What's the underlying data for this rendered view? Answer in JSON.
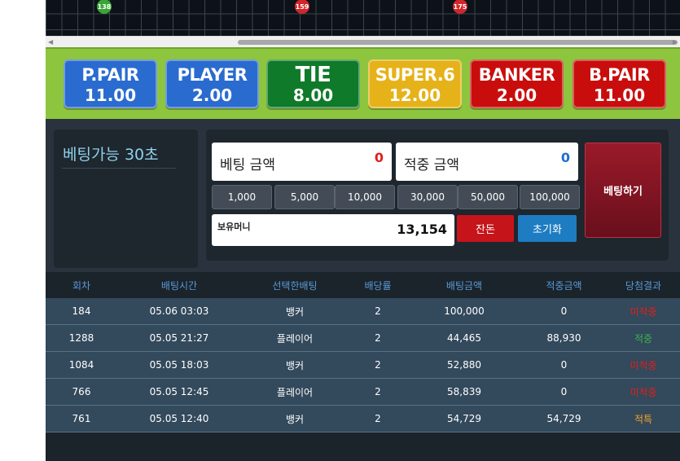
{
  "road": {
    "beads": [
      {
        "num": "138",
        "color": "green"
      },
      {
        "num": "159",
        "color": "red"
      },
      {
        "num": "175",
        "color": "red"
      }
    ]
  },
  "bets": [
    {
      "name": "P.PAIR",
      "odds": "11.00",
      "style": "blue"
    },
    {
      "name": "PLAYER",
      "odds": "2.00",
      "style": "blue"
    },
    {
      "name": "TIE",
      "odds": "8.00",
      "style": "green"
    },
    {
      "name": "SUPER.6",
      "odds": "12.00",
      "style": "yellow"
    },
    {
      "name": "BANKER",
      "odds": "2.00",
      "style": "red"
    },
    {
      "name": "B.PAIR",
      "odds": "11.00",
      "style": "red"
    }
  ],
  "timer": {
    "text": "베팅가능 30초"
  },
  "bet_amount": {
    "label": "베팅 금액",
    "value": "0"
  },
  "win_amount": {
    "label": "적중 금액",
    "value": "0"
  },
  "chips": [
    "1,000",
    "5,000",
    "10,000",
    "30,000",
    "50,000",
    "100,000"
  ],
  "money": {
    "label": "보유머니",
    "value": "13,154"
  },
  "buttons": {
    "change": "잔돈",
    "reset": "초기화",
    "place": "베팅하기"
  },
  "colors": {
    "accent_green": "#8dc53e",
    "win": "#39b54a",
    "lose": "#e0201c",
    "hit": "#f5a623"
  },
  "table": {
    "headers": [
      "회차",
      "배팅시간",
      "선택한배팅",
      "배당률",
      "배팅금액",
      "적중금액",
      "당첨결과"
    ],
    "rows": [
      {
        "round": "184",
        "time": "05.06 03:03",
        "pick": "뱅커",
        "odds": "2",
        "amount": "100,000",
        "win": "0",
        "result": "미적중",
        "rc": "#e0201c"
      },
      {
        "round": "1288",
        "time": "05.05 21:27",
        "pick": "플레이어",
        "odds": "2",
        "amount": "44,465",
        "win": "88,930",
        "result": "적중",
        "rc": "#39b54a"
      },
      {
        "round": "1084",
        "time": "05.05 18:03",
        "pick": "뱅커",
        "odds": "2",
        "amount": "52,880",
        "win": "0",
        "result": "미적중",
        "rc": "#e0201c"
      },
      {
        "round": "766",
        "time": "05.05 12:45",
        "pick": "플레이어",
        "odds": "2",
        "amount": "58,839",
        "win": "0",
        "result": "미적중",
        "rc": "#e0201c"
      },
      {
        "round": "761",
        "time": "05.05 12:40",
        "pick": "뱅커",
        "odds": "2",
        "amount": "54,729",
        "win": "54,729",
        "result": "적특",
        "rc": "#f5a623"
      }
    ]
  }
}
